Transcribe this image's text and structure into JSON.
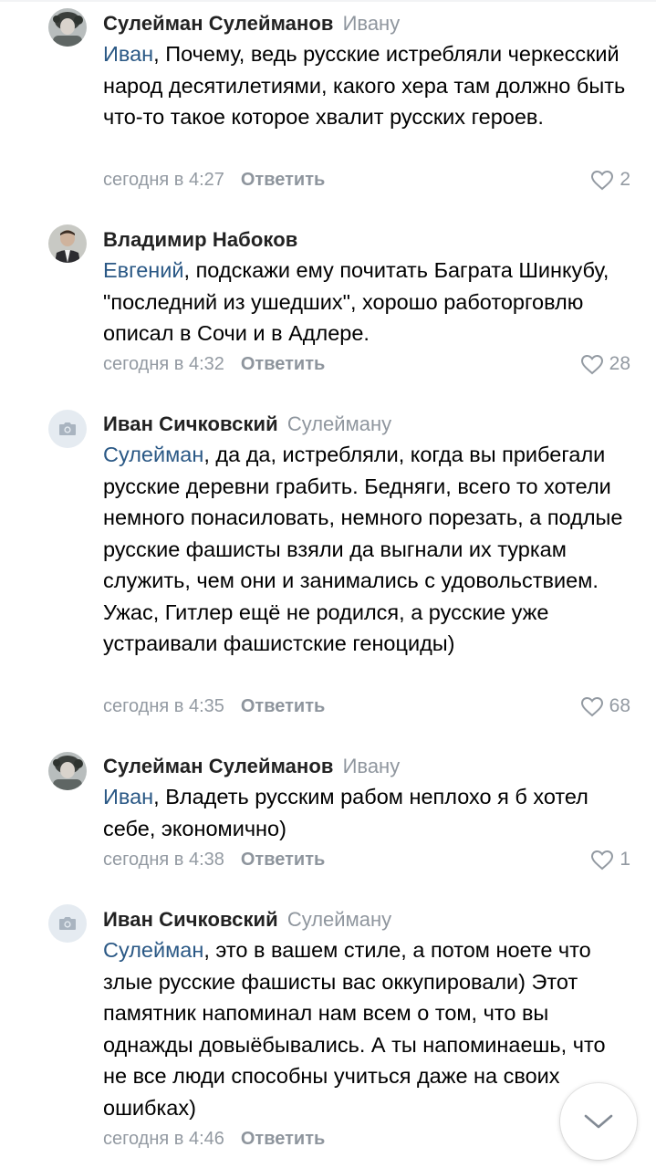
{
  "comments": [
    {
      "author": "Сулейман Сулейманов",
      "reply_to": "Ивану",
      "mention": "Иван",
      "text": ", Почему, ведь русские истребляли черкесский народ десятилетиями, какого хера там должно быть что-то такое которое хвалит русских героев.",
      "time": "сегодня в 4:27",
      "reply_label": "Ответить",
      "likes": "2",
      "avatar": "photo"
    },
    {
      "author": "Владимир Набоков",
      "reply_to": "",
      "mention": "Евгений",
      "text": ", подскажи ему почитать Баграта Шинкубу, \"последний из ушедших\", хорошо работорговлю описал в Сочи и в Адлере.",
      "time": "сегодня в 4:32",
      "reply_label": "Ответить",
      "likes": "28",
      "avatar": "photo"
    },
    {
      "author": "Иван Сичковский",
      "reply_to": "Сулейману",
      "mention": "Сулейман",
      "text": ", да да, истребляли, когда вы прибегали русские деревни грабить. Бедняги, всего то хотели немного понасиловать, немного порезать, а подлые русские фашисты взяли да выгнали их туркам служить, чем они и занимались с удовольствием. Ужас, Гитлер ещё не родился, а русские уже устраивали фашистские геноциды)",
      "time": "сегодня в 4:35",
      "reply_label": "Ответить",
      "likes": "68",
      "avatar": "camera-placeholder"
    },
    {
      "author": "Сулейман Сулейманов",
      "reply_to": "Ивану",
      "mention": "Иван",
      "text": ", Владеть русским рабом неплохо я б хотел себе, экономично)",
      "time": "сегодня в 4:38",
      "reply_label": "Ответить",
      "likes": "1",
      "avatar": "photo"
    },
    {
      "author": "Иван Сичковский",
      "reply_to": "Сулейману",
      "mention": "Сулейман",
      "text": ", это в вашем стиле, а потом ноете что злые русские фашисты вас оккупировали) Этот памятник напоминал нам всем о том, что вы однажды довыёбывались. А ты напоминаешь, что не все люди способны учиться даже на своих ошибках)",
      "time": "сегодня в 4:46",
      "reply_label": "Ответить",
      "likes": "",
      "avatar": "camera-placeholder"
    }
  ],
  "icons": {
    "like": "heart-outline-icon",
    "scroll": "chevron-down-icon",
    "placeholder": "camera-icon"
  },
  "colors": {
    "mention": "#2a5885",
    "meta": "#939aa2"
  }
}
